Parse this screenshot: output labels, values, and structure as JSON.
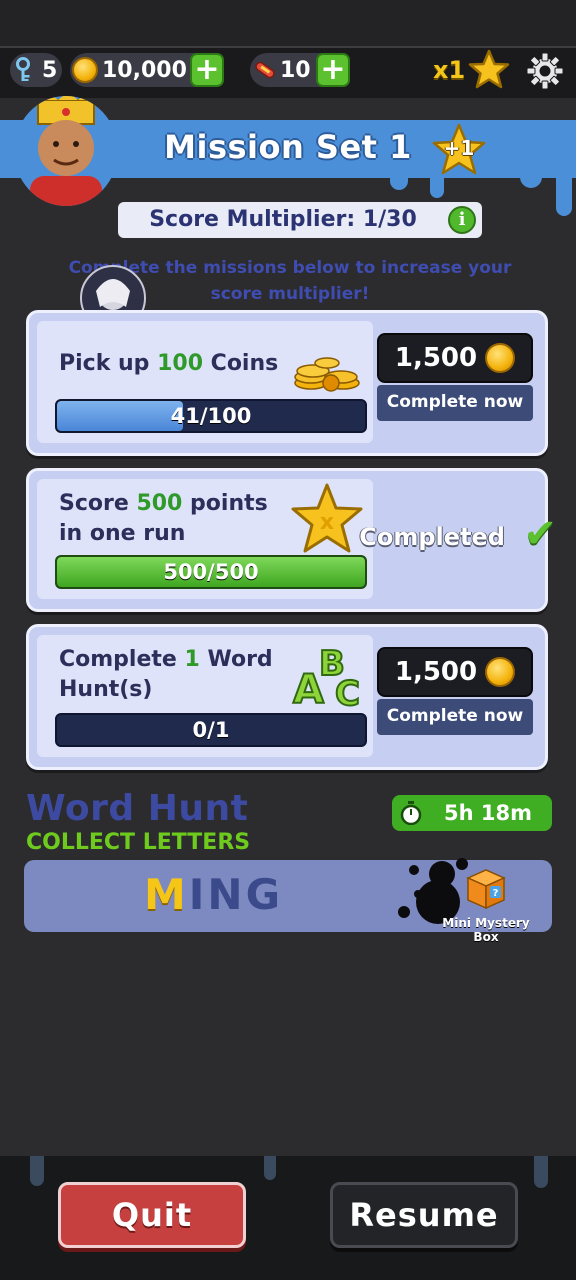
{
  "top_bar": {
    "keys": "5",
    "coins": "10,000",
    "boards": "10",
    "multiplier": "x1"
  },
  "mission_set": {
    "title": "Mission Set 1",
    "star_badge": "+1",
    "score_multiplier": "Score Multiplier: 1/30",
    "instructions": "Complete the missions below to increase your score multiplier!"
  },
  "missions": [
    {
      "prefix": "Pick up ",
      "highlight": "100",
      "suffix": " Coins",
      "progress_text": "41/100",
      "progress_fraction": 0.41,
      "reward": "1,500",
      "action": "Complete now"
    },
    {
      "prefix": "Score ",
      "highlight": "500",
      "suffix": " points in one run",
      "progress_text": "500/500",
      "progress_fraction": 1.0,
      "status": "Completed"
    },
    {
      "prefix": "Complete ",
      "highlight": "1",
      "suffix": " Word Hunt(s)",
      "progress_text": "0/1",
      "progress_fraction": 0.0,
      "reward": "1,500",
      "action": "Complete now"
    }
  ],
  "word_hunt": {
    "title": "Word Hunt",
    "subtitle": "COLLECT LETTERS",
    "timer": "5h 18m",
    "word_collected": "M",
    "word_remaining": "ING",
    "prize": "Mini Mystery Box"
  },
  "buttons": {
    "quit": "Quit",
    "resume": "Resume"
  },
  "colors": {
    "accent_blue": "#4c8fd9",
    "card_bg": "#c6cff2",
    "green": "#5cc12e",
    "quit_red": "#c64040"
  }
}
